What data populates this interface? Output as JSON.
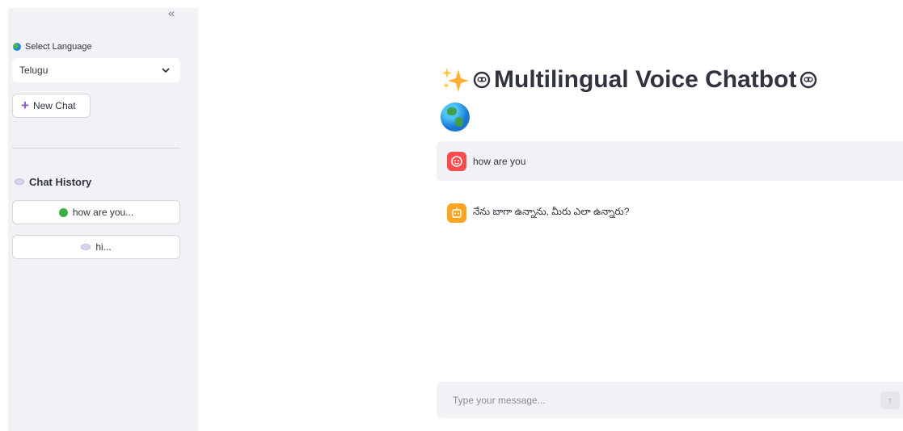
{
  "sidebar": {
    "collapse_glyph": "«",
    "language_label": "Select Language",
    "language_selected": "Telugu",
    "new_chat_label": "New Chat",
    "history_title": "Chat History",
    "history_items": [
      {
        "label": "how are you...",
        "icon": "green-circle-icon"
      },
      {
        "label": "hi...",
        "icon": "speech-bubble-icon"
      }
    ]
  },
  "main": {
    "title": "Multilingual Voice Chatbot",
    "messages": [
      {
        "role": "user",
        "text": "how are you",
        "avatar": "user-face-icon"
      },
      {
        "role": "assistant",
        "text": "నేను బాగా ఉన్నాను, మీరు ఎలా ఉన్నారు?",
        "avatar": "bot-icon"
      }
    ],
    "input_placeholder": "Type your message...",
    "send_glyph": "↑"
  },
  "colors": {
    "sidebar_bg": "#f0f2f6",
    "user_avatar": "#ff4b4b",
    "bot_avatar": "#ffa421",
    "accent_plus": "#8e56c5"
  }
}
